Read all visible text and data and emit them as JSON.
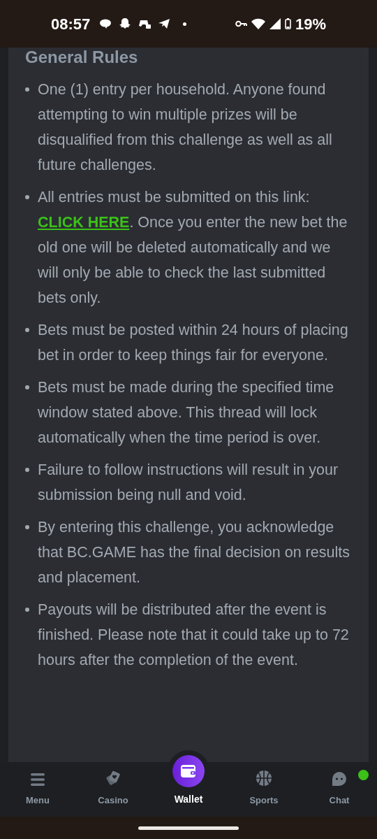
{
  "status_bar": {
    "time": "08:57",
    "battery": "19%"
  },
  "section": {
    "title": "General Rules",
    "rules": [
      {
        "text": "One (1) entry per household. Anyone found attempting to win multiple prizes will be disqualified from this challenge as well as all future challenges."
      },
      {
        "text": "All entries must be submitted on this link:",
        "link": "CLICK HERE",
        "text_after": ". Once you enter the new bet the old one will be deleted automatically and we will only be able to check the last submitted bets only."
      },
      {
        "text": "Bets must be posted within 24 hours of placing bet in order to keep things fair for everyone."
      },
      {
        "text": "Bets must be made during the specified time window stated above. This thread will lock automatically when the time period is over."
      },
      {
        "text": "Failure to follow instructions will result in your submission being null and void."
      },
      {
        "text": "By entering this challenge, you acknowledge that BC.GAME has the final decision on results and placement."
      },
      {
        "text": "Payouts will be distributed after the event is finished. Please note that it could take up to 72 hours after the completion of the event."
      }
    ]
  },
  "nav": [
    {
      "kind": "menu",
      "label": "Menu",
      "selected": false,
      "badge": false
    },
    {
      "kind": "casino",
      "label": "Casino",
      "selected": false,
      "badge": false
    },
    {
      "kind": "wallet",
      "label": "Wallet",
      "selected": true,
      "badge": false
    },
    {
      "kind": "sports",
      "label": "Sports",
      "selected": false,
      "badge": false
    },
    {
      "kind": "chat",
      "label": "Chat",
      "selected": false,
      "badge": true
    }
  ]
}
